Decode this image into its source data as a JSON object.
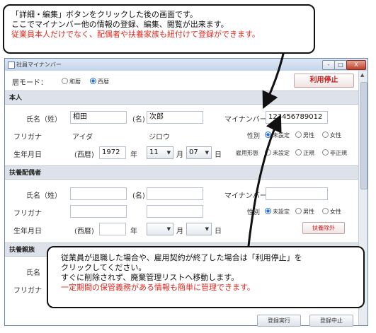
{
  "top_callout": {
    "line1": "「詳細・編集」ボタンをクリックした後の画面です。",
    "line2": "ここでマイナンバー他の情報の登録、編集、閲覧が出来ます。",
    "line3": "従業員本人だけでなく、配偶者や扶養家族も紐付けて登録ができます。"
  },
  "window": {
    "title": "社員マイナンバー",
    "mode_label": "居モード：",
    "mode_options": [
      "和暦",
      "西暦"
    ],
    "mode_selected": "西暦",
    "stop_button": "利用停止",
    "min": "-",
    "max": "□",
    "close": "X"
  },
  "honnin": {
    "section": "本人",
    "name_label": "氏名（姓）",
    "name_sei": "相田",
    "mei_label": "(名)",
    "name_mei": "次郎",
    "mynumber_label": "マイナンバー",
    "mynumber": "123456789012",
    "kana_label": "フリガナ",
    "kana_sei": "アイダ",
    "kana_mei": "ジロウ",
    "gender_label": "性別",
    "gender_options": [
      "未設定",
      "男性",
      "女性"
    ],
    "birth_label": "生年月日",
    "era": "(西暦)",
    "year": "1972",
    "year_unit": "年",
    "month": "11",
    "month_unit": "月",
    "day": "07",
    "day_unit": "日",
    "employment_label": "雇用形態",
    "employment_options": [
      "未設定",
      "正規",
      "非正規"
    ]
  },
  "spouse": {
    "section": "扶養配偶者",
    "name_label": "氏名（姓）",
    "mei_label": "(名)",
    "mynumber_label": "マイナンバー",
    "kana_label": "フリガナ",
    "gender_label": "性別",
    "gender_options": [
      "未設定",
      "男性",
      "女性"
    ],
    "birth_label": "生年月日",
    "era": "(西暦)",
    "year_unit": "年",
    "month_unit": "月",
    "day_unit": "日",
    "exclude_button": "扶養除外"
  },
  "family": {
    "section": "扶養親族",
    "name_label": "氏名",
    "kana_label": "フリガナ"
  },
  "footer": {
    "register": "登録実行",
    "cancel": "登録中止"
  },
  "bottom_callout": {
    "line1": "従業員が退職した場合や、雇用契約が終了した場合は「利用停止」を",
    "line2": "クリックしてください。",
    "line3": "すぐに削除されず、廃棄管理リストへ移動します。",
    "line4": "一定期間の保管義務がある情報も簡単に管理できます。"
  },
  "colors": {
    "accent_red": "#e0281f",
    "button_red": "#cc1a1a",
    "radio_blue": "#2a6fd0"
  }
}
